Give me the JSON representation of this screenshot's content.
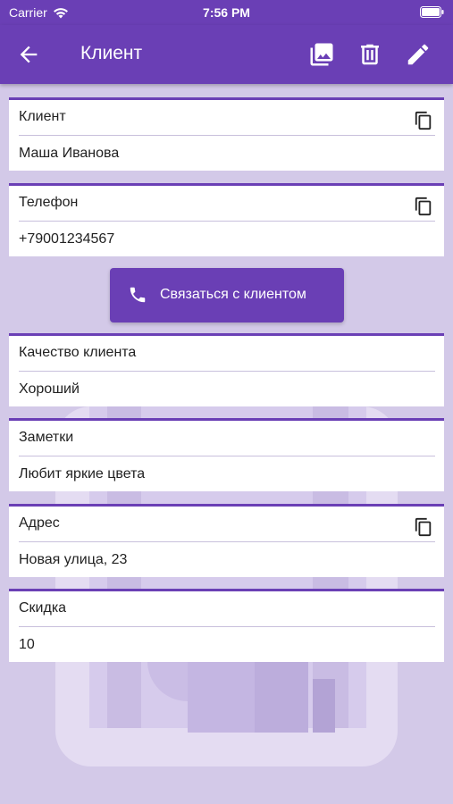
{
  "status_bar": {
    "carrier": "Carrier",
    "time": "7:56 PM"
  },
  "app_bar": {
    "title": "Клиент"
  },
  "fields": [
    {
      "label": "Клиент",
      "value": "Маша Иванова",
      "copyable": true
    },
    {
      "label": "Телефон",
      "value": "+79001234567",
      "copyable": true
    },
    {
      "label": "Качество клиента",
      "value": "Хороший",
      "copyable": false
    },
    {
      "label": "Заметки",
      "value": "Любит яркие цвета",
      "copyable": false
    },
    {
      "label": "Адрес",
      "value": "Новая улица, 23",
      "copyable": true
    },
    {
      "label": "Скидка",
      "value": "10",
      "copyable": false
    }
  ],
  "contact_button": {
    "label": "Связаться с клиентом",
    "icon": "phone-icon"
  },
  "icons": {
    "back": "arrow-left-icon",
    "gallery": "image-gallery-icon",
    "delete": "trash-icon",
    "edit": "pencil-icon",
    "copy": "copy-icon"
  },
  "colors": {
    "primary": "#6a3fb5",
    "background": "#d3c9e8",
    "card": "#ffffff"
  }
}
